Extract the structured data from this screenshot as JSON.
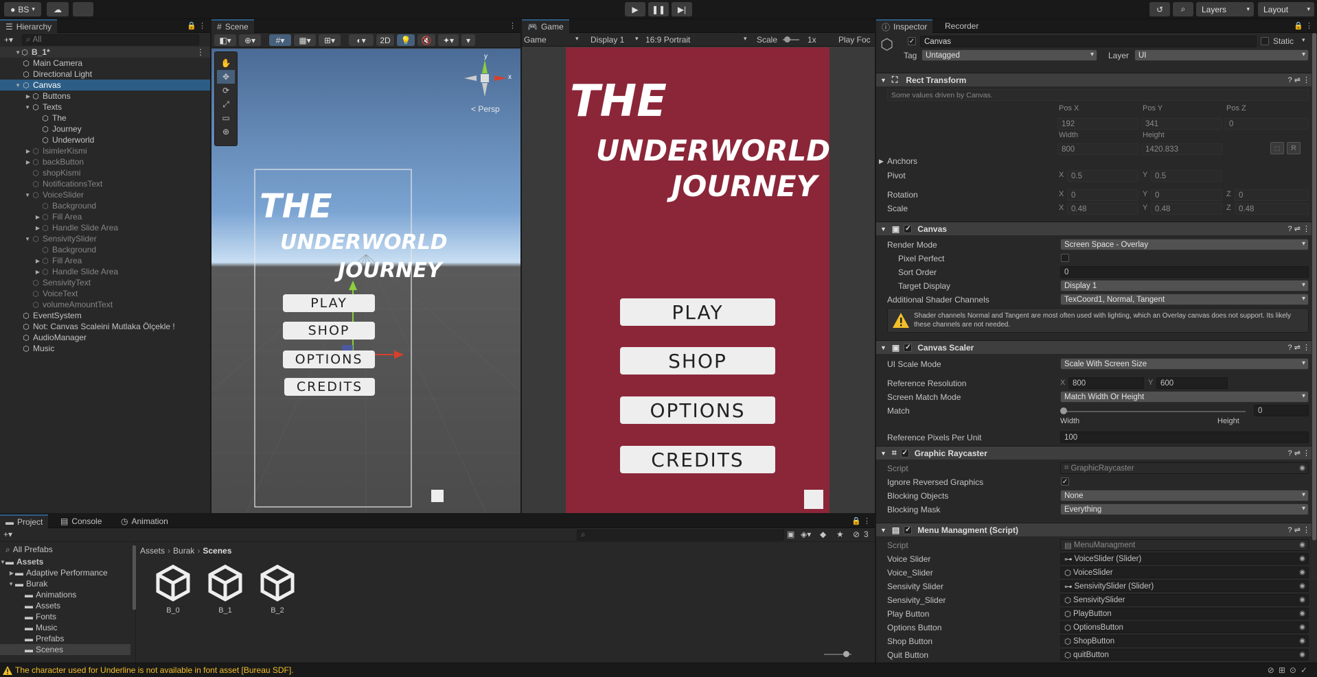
{
  "toolbar": {
    "account": "BS",
    "layers": "Layers",
    "layout": "Layout"
  },
  "hierarchy": {
    "tab": "Hierarchy",
    "search_placeholder": "All",
    "scene": "B_1*",
    "items": [
      {
        "label": "Main Camera",
        "depth": 1,
        "arrow": "",
        "dim": false,
        "sel": false
      },
      {
        "label": "Directional Light",
        "depth": 1,
        "arrow": "",
        "dim": false,
        "sel": false
      },
      {
        "label": "Canvas",
        "depth": 1,
        "arrow": "▼",
        "dim": false,
        "sel": true
      },
      {
        "label": "Buttons",
        "depth": 2,
        "arrow": "▶",
        "dim": false,
        "sel": false
      },
      {
        "label": "Texts",
        "depth": 2,
        "arrow": "▼",
        "dim": false,
        "sel": false
      },
      {
        "label": "The",
        "depth": 3,
        "arrow": "",
        "dim": false,
        "sel": false
      },
      {
        "label": "Journey",
        "depth": 3,
        "arrow": "",
        "dim": false,
        "sel": false
      },
      {
        "label": "Underworld",
        "depth": 3,
        "arrow": "",
        "dim": false,
        "sel": false
      },
      {
        "label": "IsimlerKismi",
        "depth": 2,
        "arrow": "▶",
        "dim": true,
        "sel": false
      },
      {
        "label": "backButton",
        "depth": 2,
        "arrow": "▶",
        "dim": true,
        "sel": false
      },
      {
        "label": "shopKismi",
        "depth": 2,
        "arrow": "",
        "dim": true,
        "sel": false
      },
      {
        "label": "NotificationsText",
        "depth": 2,
        "arrow": "",
        "dim": true,
        "sel": false
      },
      {
        "label": "VoiceSlider",
        "depth": 2,
        "arrow": "▼",
        "dim": true,
        "sel": false
      },
      {
        "label": "Background",
        "depth": 3,
        "arrow": "",
        "dim": true,
        "sel": false
      },
      {
        "label": "Fill Area",
        "depth": 3,
        "arrow": "▶",
        "dim": true,
        "sel": false
      },
      {
        "label": "Handle Slide Area",
        "depth": 3,
        "arrow": "▶",
        "dim": true,
        "sel": false
      },
      {
        "label": "SensivitySlider",
        "depth": 2,
        "arrow": "▼",
        "dim": true,
        "sel": false
      },
      {
        "label": "Background",
        "depth": 3,
        "arrow": "",
        "dim": true,
        "sel": false
      },
      {
        "label": "Fill Area",
        "depth": 3,
        "arrow": "▶",
        "dim": true,
        "sel": false
      },
      {
        "label": "Handle Slide Area",
        "depth": 3,
        "arrow": "▶",
        "dim": true,
        "sel": false
      },
      {
        "label": "SensivityText",
        "depth": 2,
        "arrow": "",
        "dim": true,
        "sel": false
      },
      {
        "label": "VoiceText",
        "depth": 2,
        "arrow": "",
        "dim": true,
        "sel": false
      },
      {
        "label": "volumeAmountText",
        "depth": 2,
        "arrow": "",
        "dim": true,
        "sel": false
      },
      {
        "label": "EventSystem",
        "depth": 1,
        "arrow": "",
        "dim": false,
        "sel": false
      },
      {
        "label": "Not: Canvas Scaleini Mutlaka Ölçekle !",
        "depth": 1,
        "arrow": "",
        "dim": false,
        "sel": false
      },
      {
        "label": "AudioManager",
        "depth": 1,
        "arrow": "",
        "dim": false,
        "sel": false
      },
      {
        "label": "Music",
        "depth": 1,
        "arrow": "",
        "dim": false,
        "sel": false
      }
    ]
  },
  "scene": {
    "tab": "Scene",
    "mode_2d": "2D",
    "persp": "< Persp",
    "axis_y": "y",
    "axis_x": "x",
    "title_the": "THE",
    "title_underworld": "UNDERWORLD",
    "title_journey": "JOURNEY",
    "buttons": [
      "PLAY",
      "SHOP",
      "OPTIONS",
      "CREDITS"
    ]
  },
  "game": {
    "tab": "Game",
    "view": "Game",
    "display": "Display 1",
    "aspect": "16:9 Portrait",
    "scale_label": "Scale",
    "scale_value": "1x",
    "play_focus": "Play Foc",
    "title_the": "THE",
    "title_underworld": "UNDERWORLD",
    "title_journey": "JOURNEY",
    "buttons": [
      "PLAY",
      "SHOP",
      "OPTIONS",
      "CREDITS"
    ],
    "bg_color": "#8b2639"
  },
  "inspector": {
    "tabs": [
      "Inspector",
      "Recorder"
    ],
    "object_name": "Canvas",
    "static": "Static",
    "tag_label": "Tag",
    "tag_value": "Untagged",
    "layer_label": "Layer",
    "layer_value": "UI",
    "rect": {
      "title": "Rect Transform",
      "note": "Some values driven by Canvas.",
      "pos_x_label": "Pos X",
      "pos_y_label": "Pos Y",
      "pos_z_label": "Pos Z",
      "pos_x": "192",
      "pos_y": "341",
      "pos_z": "0",
      "width_label": "Width",
      "height_label": "Height",
      "width": "800",
      "height": "1420.833",
      "anchors": "Anchors",
      "pivot": "Pivot",
      "pivot_x": "0.5",
      "pivot_y": "0.5",
      "rotation": "Rotation",
      "rot_x": "0",
      "rot_y": "0",
      "rot_z": "0",
      "scale": "Scale",
      "scale_x": "0.48",
      "scale_y": "0.48",
      "scale_z": "0.48"
    },
    "canvas": {
      "title": "Canvas",
      "render_mode_label": "Render Mode",
      "render_mode": "Screen Space - Overlay",
      "pixel_perfect": "Pixel Perfect",
      "sort_order_label": "Sort Order",
      "sort_order": "0",
      "target_display_label": "Target Display",
      "target_display": "Display 1",
      "shader_channels_label": "Additional Shader Channels",
      "shader_channels": "TexCoord1, Normal, Tangent",
      "warning": "Shader channels Normal and Tangent are most often used with lighting, which an Overlay canvas does not support. Its likely these channels are not needed."
    },
    "scaler": {
      "title": "Canvas Scaler",
      "mode_label": "UI Scale Mode",
      "mode": "Scale With Screen Size",
      "ref_res_label": "Reference Resolution",
      "ref_x": "800",
      "ref_y": "600",
      "match_mode_label": "Screen Match Mode",
      "match_mode": "Match Width Or Height",
      "match_label": "Match",
      "match_value": "0",
      "width": "Width",
      "height": "Height",
      "ppu_label": "Reference Pixels Per Unit",
      "ppu": "100"
    },
    "raycaster": {
      "title": "Graphic Raycaster",
      "script_label": "Script",
      "script": "GraphicRaycaster",
      "ignore_label": "Ignore Reversed Graphics",
      "blocking_objects_label": "Blocking Objects",
      "blocking_objects": "None",
      "blocking_mask_label": "Blocking Mask",
      "blocking_mask": "Everything"
    },
    "menu": {
      "title": "Menu Managment (Script)",
      "script_label": "Script",
      "script": "MenuManagment",
      "fields": [
        {
          "label": "Voice Slider",
          "value": "VoiceSlider (Slider)"
        },
        {
          "label": "Voice_Slider",
          "value": "VoiceSlider"
        },
        {
          "label": "Sensivity Slider",
          "value": "SensivitySlider (Slider)"
        },
        {
          "label": "Sensivity_Slider",
          "value": "SensivitySlider"
        },
        {
          "label": "Play Button",
          "value": "PlayButton"
        },
        {
          "label": "Options Button",
          "value": "OptionsButton"
        },
        {
          "label": "Shop Button",
          "value": "ShopButton"
        },
        {
          "label": "Quit Button",
          "value": "quitButton"
        }
      ]
    }
  },
  "project": {
    "tabs": [
      "Project",
      "Console",
      "Animation"
    ],
    "hidden_count": "3",
    "tree": [
      {
        "label": "All Prefabs",
        "depth": 0,
        "arrow": ""
      },
      {
        "label": "Assets",
        "depth": 0,
        "arrow": "▼"
      },
      {
        "label": "Adaptive Performance",
        "depth": 1,
        "arrow": "▶"
      },
      {
        "label": "Burak",
        "depth": 1,
        "arrow": "▼"
      },
      {
        "label": "Animations",
        "depth": 2,
        "arrow": ""
      },
      {
        "label": "Assets",
        "depth": 2,
        "arrow": ""
      },
      {
        "label": "Fonts",
        "depth": 2,
        "arrow": ""
      },
      {
        "label": "Music",
        "depth": 2,
        "arrow": ""
      },
      {
        "label": "Prefabs",
        "depth": 2,
        "arrow": ""
      },
      {
        "label": "Scenes",
        "depth": 2,
        "arrow": ""
      }
    ],
    "breadcrumb": [
      "Assets",
      "Burak",
      "Scenes"
    ],
    "files": [
      "B_0",
      "B_1",
      "B_2"
    ]
  },
  "status": {
    "message": "The character used for Underline is not available in font asset [Bureau SDF]."
  }
}
